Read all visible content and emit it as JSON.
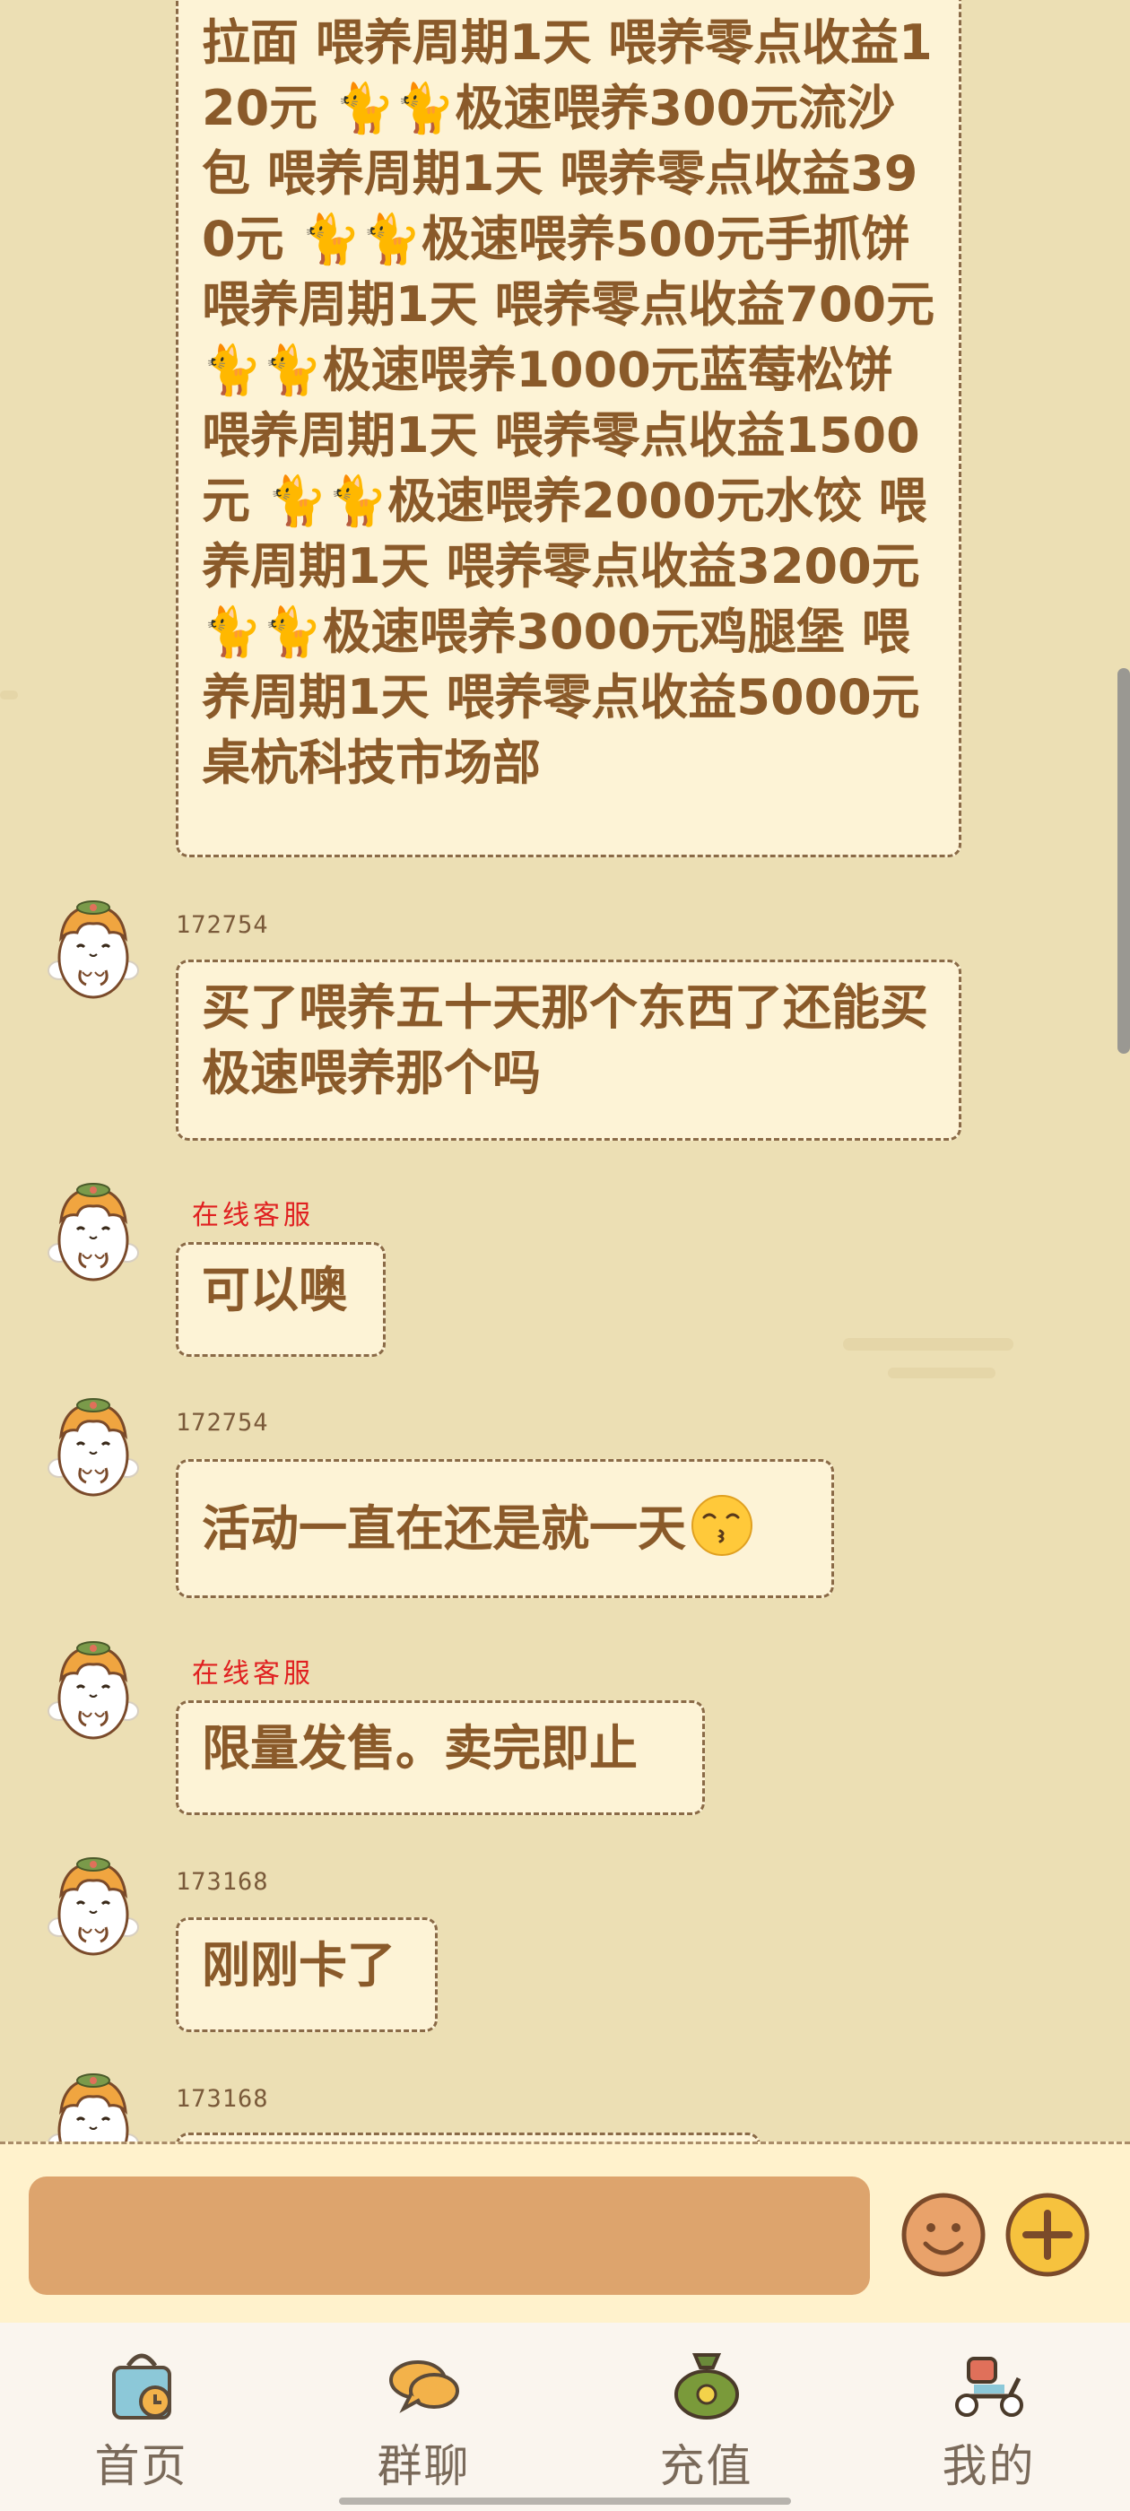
{
  "messages": [
    {
      "user": "",
      "text": "拉面 喂养周期1天 喂养零点收益120元 🐈🐈极速喂养300元流沙包 喂养周期1天 喂养零点收益390元 🐈🐈极速喂养500元手抓饼 喂养周期1天 喂养零点收益700元 🐈🐈极速喂养1000元蓝莓松饼 喂养周期1天 喂养零点收益1500元 🐈🐈极速喂养2000元水饺 喂养周期1天 喂养零点收益3200元 🐈🐈极速喂养3000元鸡腿堡 喂养周期1天 喂养零点收益5000元 桌杭科技市场部"
    },
    {
      "user": "172754",
      "text": "买了喂养五十天那个东西了还能买极速喂养那个吗"
    },
    {
      "user": "在线客服",
      "text": "可以噢"
    },
    {
      "user": "172754",
      "text": "活动一直在还是就一天"
    },
    {
      "user": "在线客服",
      "text": "限量发售。卖完即止"
    },
    {
      "user": "173168",
      "text": "刚刚卡了"
    },
    {
      "user": "173168",
      "text": ""
    }
  ],
  "input": {
    "value": "",
    "placeholder": ""
  },
  "nav": [
    {
      "label": "首页",
      "icon": "shopping-bag-icon"
    },
    {
      "label": "群聊",
      "icon": "chat-bubbles-icon"
    },
    {
      "label": "充值",
      "icon": "money-bag-icon"
    },
    {
      "label": "我的",
      "icon": "scooter-icon"
    }
  ],
  "colors": {
    "background": "#ecdfb4",
    "bubble": "#fdf3d6",
    "bubble_text": "#8a5a2a",
    "service_name": "#e02020",
    "input_field": "#dda46d",
    "nav_bg": "#faf5ee"
  }
}
